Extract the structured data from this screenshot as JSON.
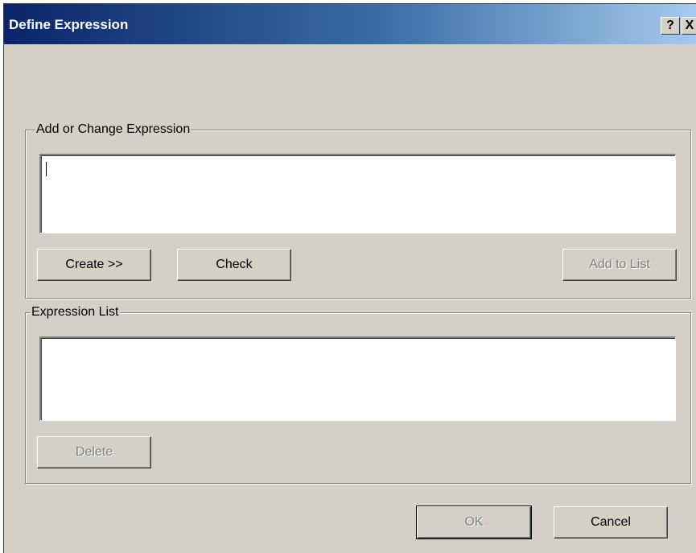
{
  "window": {
    "title": "Define Expression",
    "help_label": "?",
    "close_label": "X"
  },
  "add_group": {
    "label": "Add or Change Expression",
    "expression_value": "",
    "create_label": "Create >>",
    "check_label": "Check",
    "add_to_list_label": "Add to List"
  },
  "list_group": {
    "label": "Expression List",
    "delete_label": "Delete"
  },
  "footer": {
    "ok_label": "OK",
    "cancel_label": "Cancel"
  }
}
